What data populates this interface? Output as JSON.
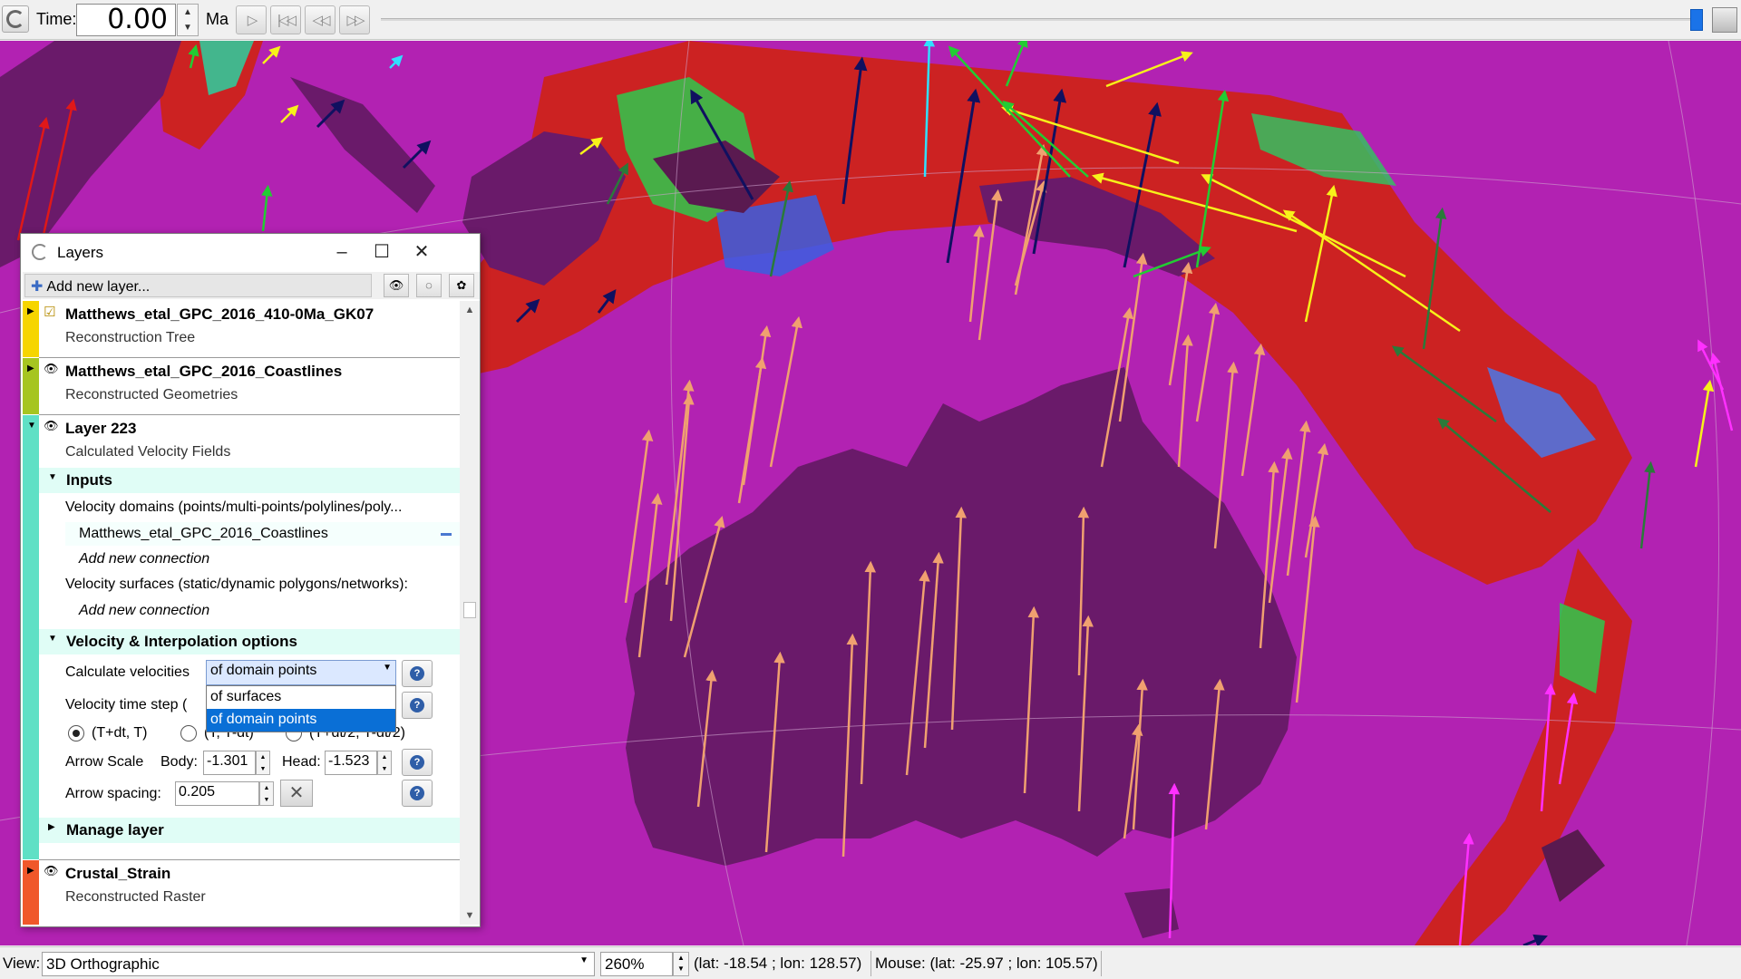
{
  "toolbar": {
    "time_label": "Time:",
    "time_value": "0.00",
    "time_unit": "Ma",
    "buttons": [
      "play",
      "go-to-start",
      "step-back",
      "step-forward"
    ]
  },
  "layers_dialog": {
    "title": "Layers",
    "add_layer_label": "Add new layer...",
    "layers": [
      {
        "name": "Matthews_etal_GPC_2016_410-0Ma_GK07",
        "type": "Reconstruction Tree",
        "color": "#f6d500"
      },
      {
        "name": "Matthews_etal_GPC_2016_Coastlines",
        "type": "Reconstructed Geometries",
        "color": "#a6c520"
      },
      {
        "name": "Layer 223",
        "type": "Calculated Velocity Fields",
        "color": "#5fe0c5"
      },
      {
        "name": "Crustal_Strain",
        "type": "Reconstructed Raster",
        "color": "#f0582a"
      }
    ],
    "inputs": {
      "header": "Inputs",
      "domains_label": "Velocity domains (points/multi-points/polylines/poly...",
      "domains_connection": "Matthews_etal_GPC_2016_Coastlines",
      "add_connection": "Add new connection",
      "surfaces_label": "Velocity surfaces (static/dynamic polygons/networks):",
      "add_connection_2": "Add new connection"
    },
    "options": {
      "header": "Velocity & Interpolation options",
      "calc_label": "Calculate velocities",
      "calc_value": "of domain points",
      "calc_options": [
        "of surfaces",
        "of domain points"
      ],
      "timestep_label": "Velocity time step (",
      "radio_options": [
        "(T+dt, T)",
        "(T, T-dt)",
        "(T+dt/2, T-dt/2)"
      ],
      "arrow_scale_label": "Arrow Scale",
      "body_label": "Body:",
      "body_value": "-1.301",
      "head_label": "Head:",
      "head_value": "-1.523",
      "spacing_label": "Arrow spacing:",
      "spacing_value": "0.205"
    },
    "manage_layer": "Manage layer"
  },
  "statusbar": {
    "view_label": "View:",
    "view_value": "3D Orthographic",
    "zoom_value": "260%",
    "camera_coords": "(lat: -18.54 ; lon: 128.57)",
    "mouse_coords": "Mouse: (lat: -25.97 ; lon: 105.57)"
  },
  "colors": {
    "ocean": "#b222b2",
    "land": "#6a1a6a",
    "strain_high": "#cc2222",
    "accent": "#0a6fd6"
  }
}
